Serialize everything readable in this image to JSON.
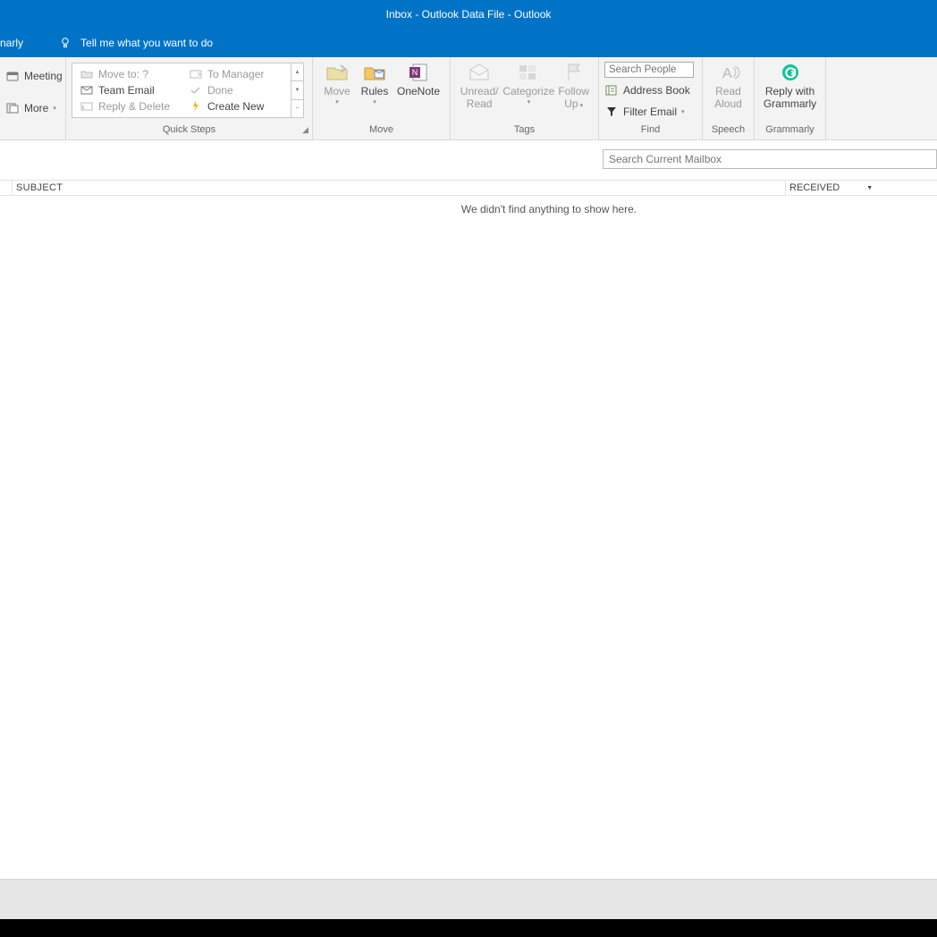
{
  "title": "Inbox - Outlook Data File  -  Outlook",
  "tellme": {
    "fragment": "narly",
    "prompt": "Tell me what you want to do"
  },
  "left_stub": {
    "meeting": "Meeting",
    "more": "More"
  },
  "quicksteps": {
    "label": "Quick Steps",
    "items": [
      {
        "label": "Move to: ?"
      },
      {
        "label": "Team Email"
      },
      {
        "label": "Reply & Delete"
      },
      {
        "label": "To Manager"
      },
      {
        "label": "Done"
      },
      {
        "label": "Create New"
      }
    ]
  },
  "move": {
    "label": "Move",
    "move_btn": "Move",
    "rules_btn": "Rules",
    "onenote_btn": "OneNote"
  },
  "tags": {
    "label": "Tags",
    "unread": "Unread/",
    "read": "Read",
    "categorize": "Categorize",
    "followup": "Follow",
    "up": "Up"
  },
  "find": {
    "label": "Find",
    "search_people_placeholder": "Search People",
    "address_book": "Address Book",
    "filter_email": "Filter Email"
  },
  "speech": {
    "label": "Speech",
    "read": "Read",
    "aloud": "Aloud"
  },
  "grammarly": {
    "label": "Grammarly",
    "reply": "Reply with",
    "name": "Grammarly"
  },
  "search_mailbox_placeholder": "Search Current Mailbox",
  "columns": {
    "subject": "SUBJECT",
    "received": "RECEIVED"
  },
  "empty_message": "We didn't find anything to show here."
}
